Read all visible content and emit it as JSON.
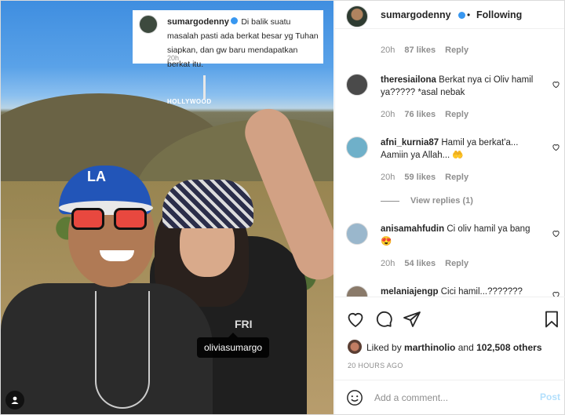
{
  "photo": {
    "caption": {
      "username": "sumargodenny",
      "text": "Di balik suatu masalah pasti ada berkat besar yg Tuhan siapkan, dan gw baru mendapatkan berkat itu.",
      "time": "20h"
    },
    "tagged_user": "oliviasumargo"
  },
  "header": {
    "username": "sumargodenny",
    "separator": "•",
    "follow_status": "Following"
  },
  "comments": {
    "top_meta": {
      "time": "20h",
      "likes": "87 likes",
      "reply": "Reply"
    },
    "items": [
      {
        "username": "theresiailona",
        "text": "Berkat nya ci Oliv hamil ya????? *asal nebak",
        "time": "20h",
        "likes": "76 likes",
        "reply": "Reply",
        "avatar_color": "#4a4a4a"
      },
      {
        "username": "afni_kurnia87",
        "text": "Hamil ya berkat'a... Aamiin ya Allah... 🤲",
        "time": "20h",
        "likes": "59 likes",
        "reply": "Reply",
        "avatar_color": "#6fb0c9"
      },
      {
        "username": "anisamahfudin",
        "text": "Ci oliv hamil ya bang 😍",
        "time": "20h",
        "likes": "54 likes",
        "reply": "Reply",
        "avatar_color": "#9ab7cc"
      },
      {
        "username": "melaniajengp",
        "text": "Cici hamil...???????",
        "avatar_color": "#8a7a6a"
      }
    ],
    "view_replies": "View replies (1)"
  },
  "actions": {
    "icons": [
      "heart-icon",
      "comment-icon",
      "share-icon",
      "bookmark-icon"
    ],
    "liked_by_prefix": "Liked by",
    "liked_by_user": "marthinolio",
    "liked_by_suffix": "and",
    "liked_by_count": "102,508 others",
    "time_ago": "20 HOURS AGO"
  },
  "add_comment": {
    "placeholder": "Add a comment...",
    "post_label": "Post",
    "post_color": "#b2dffc"
  }
}
